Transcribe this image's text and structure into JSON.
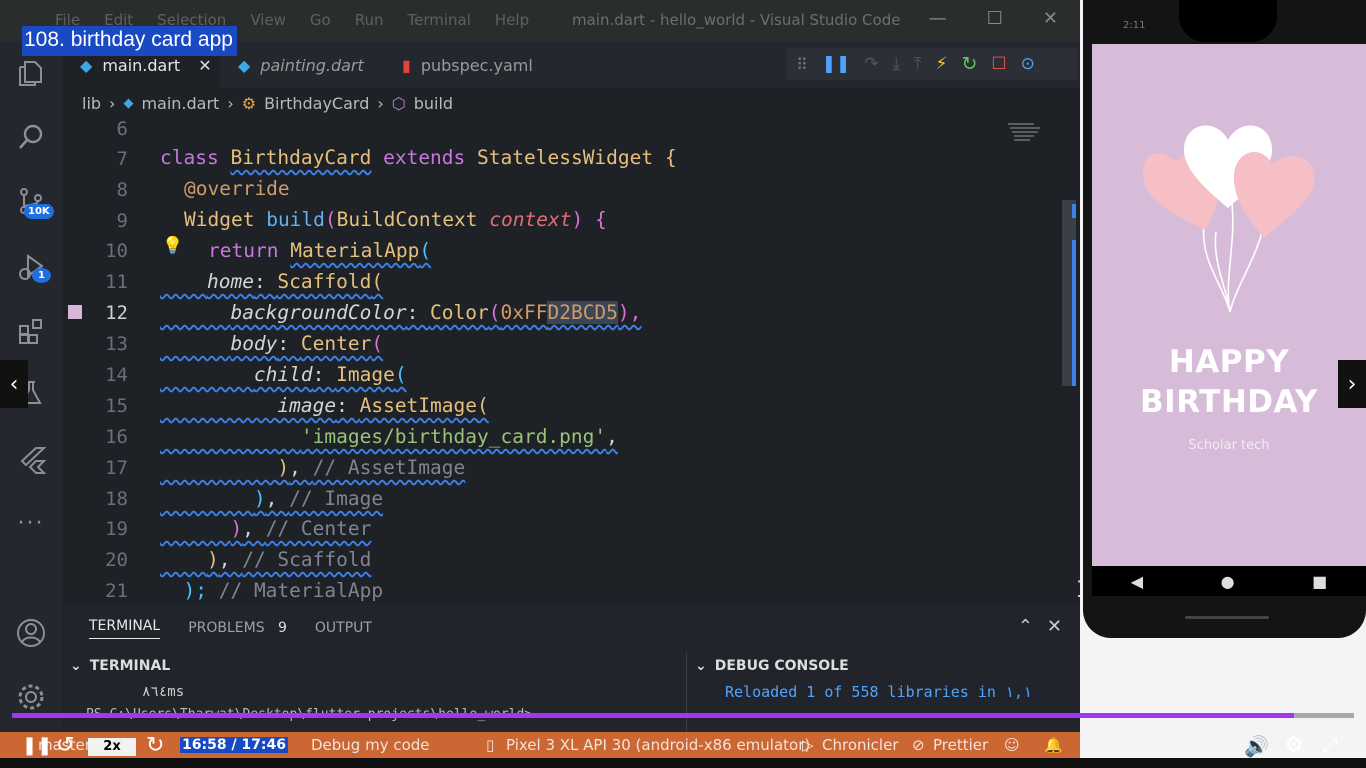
{
  "video": {
    "title": "108. birthday card app",
    "speed": "2x",
    "time": "16:58 / 17:46",
    "progress": 0.955,
    "accent": "#a435f0"
  },
  "window": {
    "menus": [
      "File",
      "Edit",
      "Selection",
      "View",
      "Go",
      "Run",
      "Terminal",
      "Help"
    ],
    "title": "main.dart - hello_world - Visual Studio Code"
  },
  "activity": {
    "source_control_badge": "10K",
    "run_badge": "1"
  },
  "tabs": [
    {
      "label": "main.dart",
      "close": "✕"
    },
    {
      "label": "painting.dart"
    },
    {
      "label": "pubspec.yaml"
    }
  ],
  "breadcrumb": {
    "items": [
      "lib",
      "main.dart",
      "BirthdayCard",
      "build"
    ],
    "sep": "›"
  },
  "editor": {
    "lines": [
      "6",
      "7",
      "8",
      "9",
      "10",
      "11",
      "12",
      "13",
      "14",
      "15",
      "16",
      "17",
      "18",
      "19",
      "20",
      "21"
    ],
    "current_line": "12",
    "code": {
      "l7": {
        "kw1": "class",
        "name": "BirthdayCard",
        "kw2": "extends",
        "base": "StatelessWidget",
        "brace": "{"
      },
      "l8": {
        "anno": "@override"
      },
      "l9": {
        "type": "Widget",
        "fn": "build",
        "ctx_type": "BuildContext",
        "param": "context",
        "tail": ") {"
      },
      "l10": {
        "kw": "return",
        "fn": "MaterialApp",
        "paren": "("
      },
      "l11": {
        "prop": "home",
        "fn": "Scaffold",
        "paren": "("
      },
      "l12": {
        "prop": "backgroundColor",
        "fn": "Color",
        "num1": "0xFF",
        "num2": "D2BCD5",
        "tail": "),"
      },
      "l13": {
        "prop": "body",
        "fn": "Center",
        "paren": "("
      },
      "l14": {
        "prop": "child",
        "fn": "Image",
        "paren": "("
      },
      "l15": {
        "prop": "image",
        "fn": "AssetImage",
        "paren": "("
      },
      "l16": {
        "str": "'images/birthday_card.png'",
        "tail": ","
      },
      "l17": {
        "close": ")",
        "comment": "// AssetImage"
      },
      "l18": {
        "close": ")",
        "comment": "// Image"
      },
      "l19": {
        "close": ")",
        "comment": "// Center"
      },
      "l20": {
        "close": ")",
        "comment": "// Scaffold"
      },
      "l21": {
        "close": ");",
        "comment": "// MaterialApp"
      }
    }
  },
  "panel": {
    "tabs": [
      {
        "label": "TERMINAL"
      },
      {
        "label": "PROBLEMS",
        "count": "9"
      },
      {
        "label": "OUTPUT"
      }
    ],
    "terminal_header": "TERMINAL",
    "terminal_lines": [
      "٨٦٤ms",
      "PS C:\\Users\\Tharwat\\Desktop\\flutter projects\\hello_world>"
    ],
    "debug_header": "DEBUG CONSOLE",
    "debug_line": "Reloaded 1 of 558 libraries in ١,١"
  },
  "statusbar": {
    "branch": "master",
    "debug": "Debug my code",
    "device": "Pixel 3 XL API 30 (android-x86 emulator)",
    "chronicler": "Chronicler",
    "prettier": "Prettier",
    "color": "#cc6633"
  },
  "phone": {
    "status_time": "2:11",
    "happy": "HAPPY",
    "birthday": "BIRTHDAY",
    "scholar": "Scholar tech",
    "bg": "#d6bcd8"
  }
}
